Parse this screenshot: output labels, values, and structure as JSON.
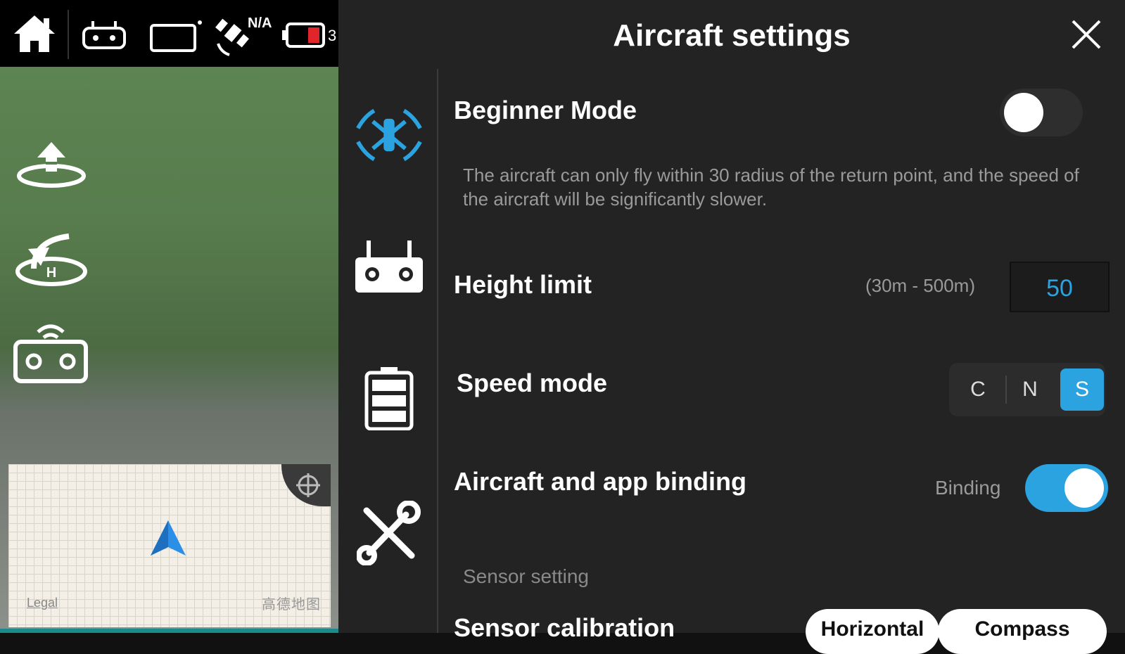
{
  "status_bar": {
    "satellite_count": "N/A",
    "battery_text": "3"
  },
  "panel": {
    "title": "Aircraft settings"
  },
  "beginner_mode": {
    "label": "Beginner Mode",
    "description": "The aircraft can only fly within 30 radius of the return point, and the speed of the aircraft will be significantly slower.",
    "enabled": false
  },
  "height_limit": {
    "label": "Height limit",
    "range": "(30m - 500m)",
    "value": "50"
  },
  "speed_mode": {
    "label": "Speed mode",
    "options": [
      "C",
      "N",
      "S"
    ],
    "selected": "S"
  },
  "binding": {
    "label": "Aircraft and app binding",
    "status": "Binding",
    "enabled": true
  },
  "sensor": {
    "section_label": "Sensor setting",
    "calibration_label": "Sensor calibration",
    "buttons": [
      "Horizontal",
      "Compass"
    ]
  },
  "minimap": {
    "legal": "Legal",
    "brand": "高德地图"
  },
  "colors": {
    "accent": "#2aa3e0",
    "panel_bg": "#232323"
  }
}
